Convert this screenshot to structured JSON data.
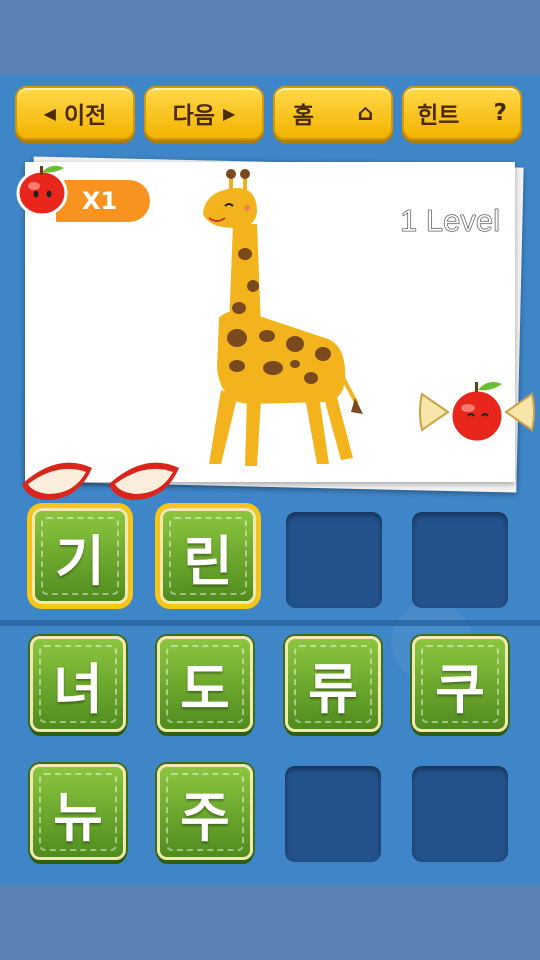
{
  "nav": {
    "prev_label": "이전",
    "next_label": "다음",
    "home_label": "홈",
    "hint_label": "힌트",
    "hint_symbol": "?",
    "prev_arrow": "◀",
    "next_arrow": "▶",
    "home_glyph": "⌂"
  },
  "puzzle": {
    "multiplier": "X1",
    "level": "1 Level"
  },
  "answer_slots": [
    "기",
    "린",
    "",
    ""
  ],
  "letter_choices": [
    "녀",
    "도",
    "류",
    "쿠",
    "뉴",
    "주",
    "",
    ""
  ],
  "colors": {
    "button": "#f3b300",
    "tile": "#6aa82e",
    "badge": "#f7931e",
    "background": "#3f86c8"
  }
}
